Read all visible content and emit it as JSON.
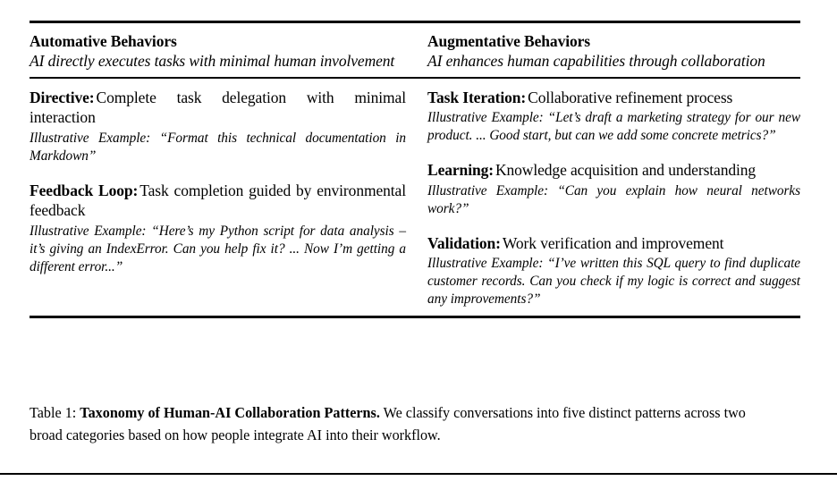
{
  "table": {
    "columns": [
      {
        "category": "Automative Behaviors",
        "description": "AI directly executes tasks with minimal human involvement",
        "entries": [
          {
            "name": "Directive:",
            "description": "Complete task delegation with minimal interaction",
            "example_label": "Illustrative Example:",
            "example_text": "“Format this technical documentation in Markdown”"
          },
          {
            "name": "Feedback Loop:",
            "description": "Task completion guided by environmental feedback",
            "example_label": "Illustrative Example:",
            "example_text": "“Here’s my Python script for data analysis – it’s giving an IndexError. Can you help fix it? ... Now I’m getting a different error...”"
          }
        ]
      },
      {
        "category": "Augmentative Behaviors",
        "description": "AI enhances human capabilities through collaboration",
        "entries": [
          {
            "name": "Task Iteration:",
            "description": "Collaborative refinement process",
            "example_label": "Illustrative Example:",
            "example_text": "“Let’s draft a marketing strategy for our new product. ... Good start, but can we add some concrete metrics?”"
          },
          {
            "name": "Learning:",
            "description": "Knowledge acquisition and understanding",
            "example_label": "Illustrative Example:",
            "example_text": "“Can you explain how neural networks work?”"
          },
          {
            "name": "Validation:",
            "description": "Work verification and improvement",
            "example_label": "Illustrative Example:",
            "example_text": "“I’ve written this SQL query to find duplicate customer records. Can you check if my logic is correct and suggest any improvements?”"
          }
        ]
      }
    ]
  },
  "caption": {
    "lead": "Table 1:",
    "bold": "Taxonomy of Human-AI Collaboration Patterns.",
    "rest": "We classify conversations into five distinct patterns across two broad categories based on how people integrate AI into their workflow."
  }
}
